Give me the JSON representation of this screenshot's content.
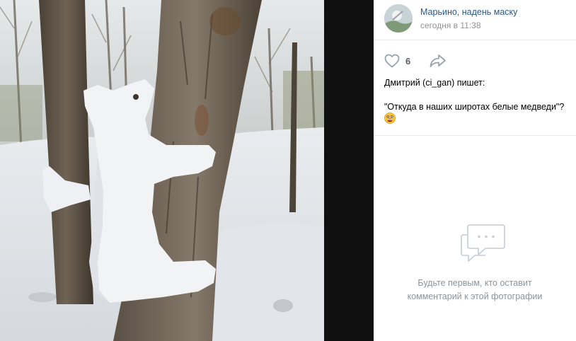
{
  "photo": {
    "description_icon": "snow-sculpture-photo"
  },
  "post": {
    "group_name": "Марьино, надень маску",
    "time": "сегодня в 11:38",
    "likes": "6",
    "author_line": "Дмитрий (ci_gan) пишет:",
    "caption": "\"Откуда в наших широтах белые медведи\"?",
    "emoji_icon": "grinning-face-icon"
  },
  "comments": {
    "empty_line1": "Будьте первым, кто оставит",
    "empty_line2": "комментарий к этой фотографии"
  },
  "colors": {
    "link": "#2a5885",
    "muted": "#939393",
    "viewer_background": "#101010",
    "icon": "#99a2ad"
  }
}
